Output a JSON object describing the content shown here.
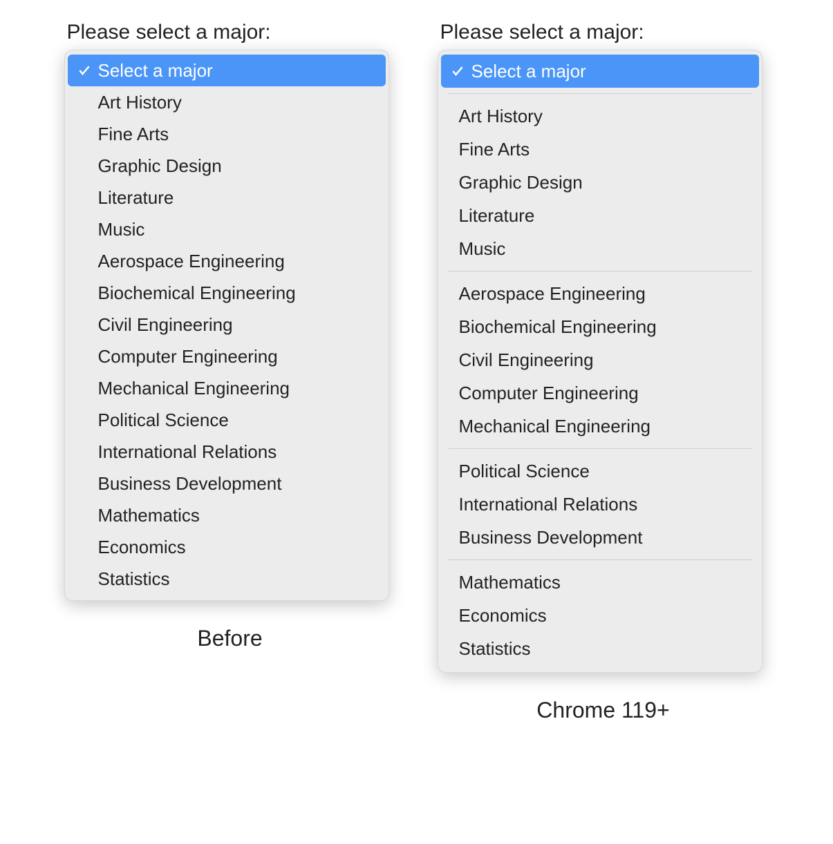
{
  "colors": {
    "accent": "#4a95f7",
    "panel_bg": "#ececec",
    "panel_border": "#d9d9d9",
    "text": "#222222"
  },
  "labels": {
    "prompt": "Please select a major:",
    "placeholder": "Select a major",
    "caption_before": "Before",
    "caption_after": "Chrome 119+"
  },
  "variants": {
    "before": {
      "selected_index": 0,
      "items": [
        {
          "label": "Select a major",
          "checked": true
        },
        {
          "label": "Art History"
        },
        {
          "label": "Fine Arts"
        },
        {
          "label": "Graphic Design"
        },
        {
          "label": "Literature"
        },
        {
          "label": "Music"
        },
        {
          "label": "Aerospace Engineering"
        },
        {
          "label": "Biochemical Engineering"
        },
        {
          "label": "Civil Engineering"
        },
        {
          "label": "Computer Engineering"
        },
        {
          "label": "Mechanical Engineering"
        },
        {
          "label": "Political Science"
        },
        {
          "label": "International Relations"
        },
        {
          "label": "Business Development"
        },
        {
          "label": "Mathematics"
        },
        {
          "label": "Economics"
        },
        {
          "label": "Statistics"
        }
      ]
    },
    "after": {
      "selected_index": 0,
      "groups": [
        {
          "items": [
            {
              "label": "Select a major",
              "checked": true
            }
          ]
        },
        {
          "items": [
            {
              "label": "Art History"
            },
            {
              "label": "Fine Arts"
            },
            {
              "label": "Graphic Design"
            },
            {
              "label": "Literature"
            },
            {
              "label": "Music"
            }
          ]
        },
        {
          "items": [
            {
              "label": "Aerospace Engineering"
            },
            {
              "label": "Biochemical Engineering"
            },
            {
              "label": "Civil Engineering"
            },
            {
              "label": "Computer Engineering"
            },
            {
              "label": "Mechanical Engineering"
            }
          ]
        },
        {
          "items": [
            {
              "label": "Political Science"
            },
            {
              "label": "International Relations"
            },
            {
              "label": "Business Development"
            }
          ]
        },
        {
          "items": [
            {
              "label": "Mathematics"
            },
            {
              "label": "Economics"
            },
            {
              "label": "Statistics"
            }
          ]
        }
      ]
    }
  }
}
